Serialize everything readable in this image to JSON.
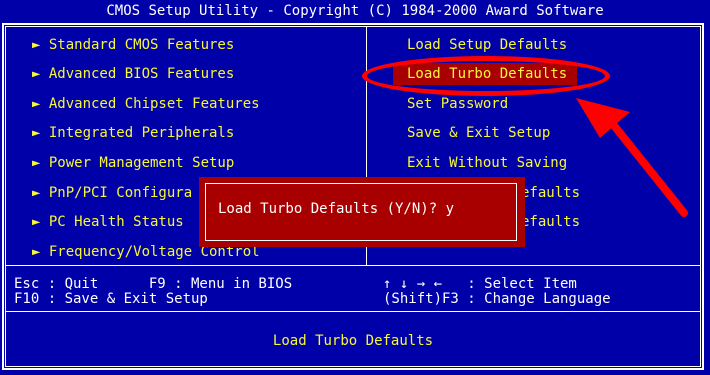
{
  "title": "CMOS Setup Utility - Copyright (C) 1984-2000 Award Software",
  "left_menu": [
    "Standard CMOS Features",
    "Advanced BIOS Features",
    "Advanced Chipset Features",
    "Integrated Peripherals",
    "Power Management Setup",
    "PnP/PCI Configura",
    "PC Health Status",
    "Frequency/Voltage Control"
  ],
  "right_menu": [
    "Load Setup Defaults",
    "Load Turbo Defaults",
    "Set Password",
    "Save & Exit Setup",
    "Exit Without Saving",
    "efaults",
    "efaults"
  ],
  "selected_item": "Load Turbo Defaults",
  "dialog": {
    "prompt": "Load Turbo Defaults (Y/N)? y"
  },
  "help": {
    "line1_left": "Esc : Quit      F9 : Menu in BIOS",
    "line2_left": "F10 : Save & Exit Setup",
    "line1_right": "↑ ↓ → ←   : Select Item",
    "line2_right": "(Shift)F3 : Change Language"
  },
  "status_text": "Load Turbo Defaults",
  "colors": {
    "background": "#0000a8",
    "text": "#f8f838",
    "highlight": "#a80000",
    "annotation": "#ff0000"
  },
  "icons": {
    "menu_bullet": "triangle-right-icon",
    "annotation": "red-arrow-icon"
  }
}
